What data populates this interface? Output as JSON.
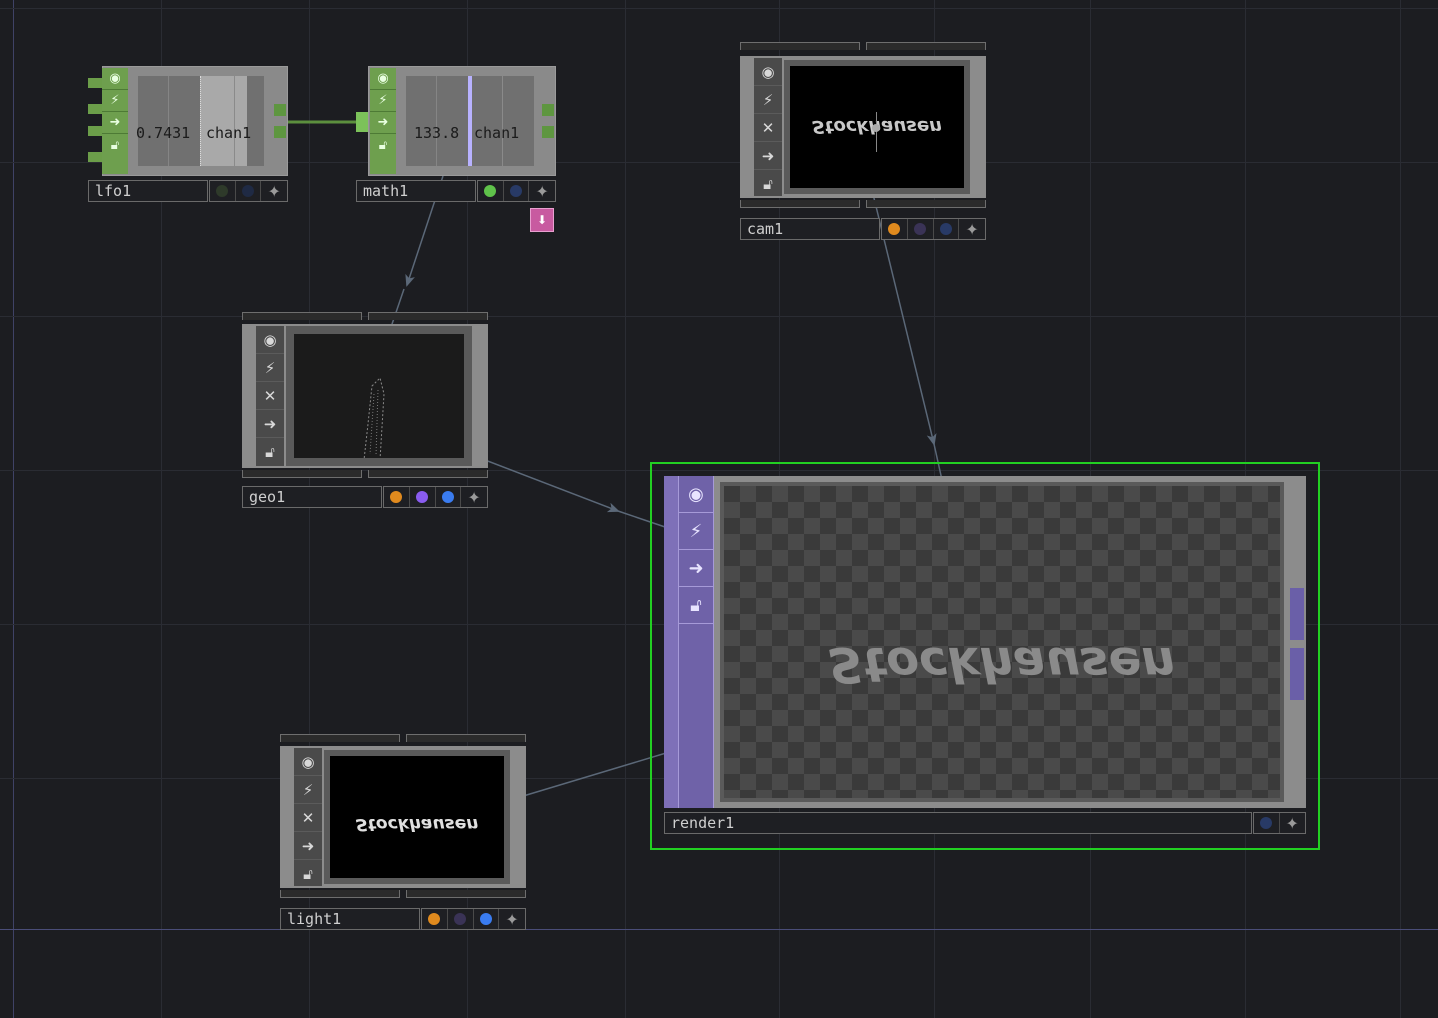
{
  "nodes": {
    "lfo1": {
      "name": "lfo1",
      "value": "0.7431",
      "channel": "chan1",
      "flags": [
        "viewer-icon",
        "cook-icon",
        "bypass-icon",
        "lock-icon"
      ]
    },
    "math1": {
      "name": "math1",
      "value": "133.8",
      "channel": "chan1"
    },
    "cam1": {
      "name": "cam1",
      "preview_text": "Stockhausen"
    },
    "geo1": {
      "name": "geo1"
    },
    "render1": {
      "name": "render1",
      "preview_text": "Stockhausen"
    },
    "light1": {
      "name": "light1",
      "preview_text": "Stockhausen"
    }
  },
  "colors": {
    "background": "#1c1d21",
    "chop_green": "#6e9f4e",
    "selection_green": "#22d022",
    "render_purple": "#7e70b8",
    "wire": "#5b6878",
    "dot_orange": "#e08a1e",
    "dot_purple": "#8a5cf0",
    "dot_blue": "#3a7cf0",
    "dot_green": "#5fc24a",
    "dot_navy": "#283a66"
  }
}
